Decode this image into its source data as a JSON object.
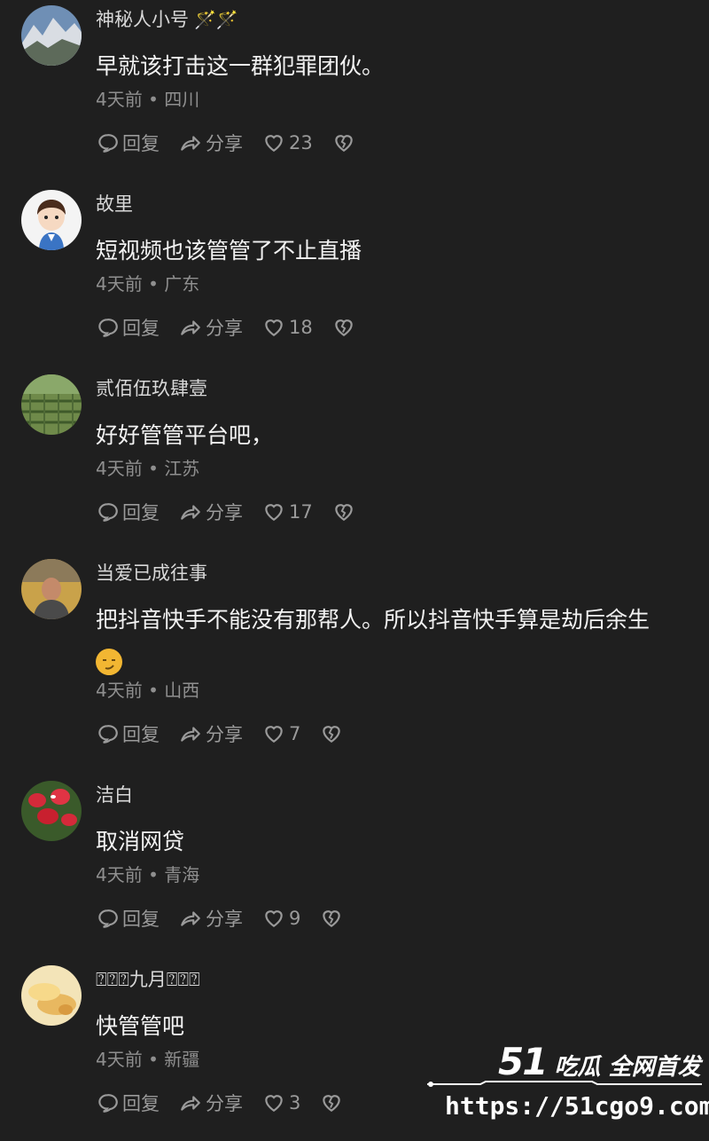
{
  "comments": [
    {
      "user": "神秘人小号",
      "badge": "🪄🪄",
      "text": "早就该打击这一群犯罪团伙。",
      "meta": "4天前 • 四川",
      "reply": "回复",
      "share": "分享",
      "likes": "23",
      "avatar": "mountain-avatar"
    },
    {
      "user": "故里",
      "text": "短视频也该管管了不止直播",
      "meta": "4天前 • 广东",
      "reply": "回复",
      "share": "分享",
      "likes": "18",
      "avatar": "cartoon-boy-avatar"
    },
    {
      "user": "贰佰伍玖肆壹",
      "text": "好好管管平台吧，",
      "meta": "4天前 • 江苏",
      "reply": "回复",
      "share": "分享",
      "likes": "17",
      "avatar": "field-avatar"
    },
    {
      "user": "当爱已成往事",
      "text": "把抖音快手不能没有那帮人。所以抖音快手算是劫后余生",
      "meta": "4天前 • 山西",
      "reply": "回复",
      "share": "分享",
      "likes": "7",
      "avatar": "man-photo-avatar"
    },
    {
      "user": "洁白",
      "text": "取消网贷",
      "meta": "4天前 • 青海",
      "reply": "回复",
      "share": "分享",
      "likes": "9",
      "avatar": "red-flowers-avatar"
    },
    {
      "user": "⍰⍰⍰九月⍰⍰⍰",
      "text": "快管管吧",
      "meta": "4天前 • 新疆",
      "reply": "回复",
      "share": "分享",
      "likes": "3",
      "avatar": "bread-avatar"
    }
  ],
  "watermark": {
    "logo_num": "51",
    "logo_text": "吃瓜 全网首发",
    "url": "https://51cgo9.com"
  },
  "colors": {
    "background": "#1f1f1f",
    "text": "#f2f2f2",
    "muted": "#8f8f8f",
    "icon": "#9a9a9a"
  }
}
